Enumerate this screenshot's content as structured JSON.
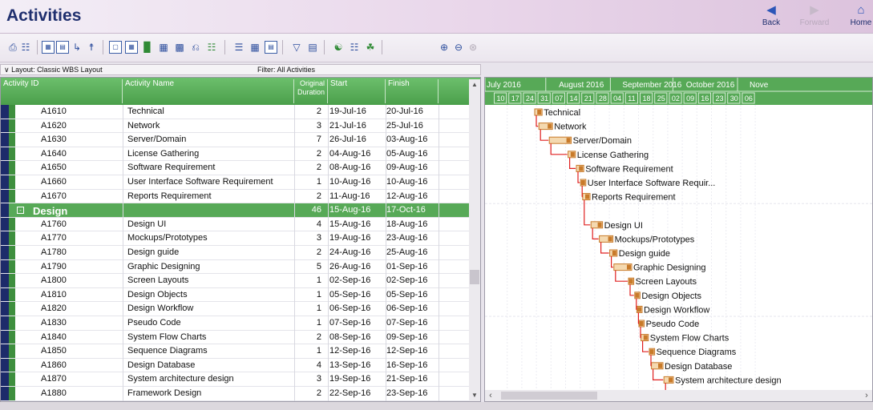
{
  "header": {
    "title": "Activities",
    "back_label": "Back",
    "forward_label": "Forward",
    "home_label": "Home"
  },
  "toolbar": {
    "icons": [
      "print-icon",
      "print-preview-icon",
      "columns-icon",
      "bars-icon",
      "relationship-icon",
      "wbs-icon",
      "layout-icon",
      "table-icon",
      "chart-icon",
      "chart-icon",
      "chart-icon",
      "chart-icon",
      "tree-icon",
      "filter-icon",
      "group-icon",
      "zoom-in-icon",
      "zoom-out-icon"
    ]
  },
  "layoutbar": {
    "layout_label": "∨ Layout: Classic WBS Layout",
    "filter_label": "Filter: All Activities"
  },
  "table": {
    "headers": {
      "activity_id": "Activity ID",
      "activity_name": "Activity Name",
      "duration": "Original Duration",
      "start": "Start",
      "finish": "Finish"
    },
    "rows": [
      {
        "id": "A1610",
        "name": "Technical",
        "dur": "2",
        "start": "19-Jul-16",
        "finish": "20-Jul-16"
      },
      {
        "id": "A1620",
        "name": "Network",
        "dur": "3",
        "start": "21-Jul-16",
        "finish": "25-Jul-16"
      },
      {
        "id": "A1630",
        "name": "Server/Domain",
        "dur": "7",
        "start": "26-Jul-16",
        "finish": "03-Aug-16"
      },
      {
        "id": "A1640",
        "name": "License Gathering",
        "dur": "2",
        "start": "04-Aug-16",
        "finish": "05-Aug-16"
      },
      {
        "id": "A1650",
        "name": "Software Requirement",
        "dur": "2",
        "start": "08-Aug-16",
        "finish": "09-Aug-16"
      },
      {
        "id": "A1660",
        "name": "User Interface Software Requirement",
        "dur": "1",
        "start": "10-Aug-16",
        "finish": "10-Aug-16"
      },
      {
        "id": "A1670",
        "name": "Reports Requirement",
        "dur": "2",
        "start": "11-Aug-16",
        "finish": "12-Aug-16"
      },
      {
        "id": "",
        "name": "Design",
        "dur": "46",
        "start": "15-Aug-16",
        "finish": "17-Oct-16",
        "wbs": true
      },
      {
        "id": "A1760",
        "name": "Design UI",
        "dur": "4",
        "start": "15-Aug-16",
        "finish": "18-Aug-16"
      },
      {
        "id": "A1770",
        "name": "Mockups/Prototypes",
        "dur": "3",
        "start": "19-Aug-16",
        "finish": "23-Aug-16"
      },
      {
        "id": "A1780",
        "name": "Design guide",
        "dur": "2",
        "start": "24-Aug-16",
        "finish": "25-Aug-16"
      },
      {
        "id": "A1790",
        "name": "Graphic Designing",
        "dur": "5",
        "start": "26-Aug-16",
        "finish": "01-Sep-16"
      },
      {
        "id": "A1800",
        "name": "Screen Layouts",
        "dur": "1",
        "start": "02-Sep-16",
        "finish": "02-Sep-16"
      },
      {
        "id": "A1810",
        "name": "Design Objects",
        "dur": "1",
        "start": "05-Sep-16",
        "finish": "05-Sep-16"
      },
      {
        "id": "A1820",
        "name": "Design Workflow",
        "dur": "1",
        "start": "06-Sep-16",
        "finish": "06-Sep-16"
      },
      {
        "id": "A1830",
        "name": "Pseudo Code",
        "dur": "1",
        "start": "07-Sep-16",
        "finish": "07-Sep-16"
      },
      {
        "id": "A1840",
        "name": "System Flow Charts",
        "dur": "2",
        "start": "08-Sep-16",
        "finish": "09-Sep-16"
      },
      {
        "id": "A1850",
        "name": "Sequence Diagrams",
        "dur": "1",
        "start": "12-Sep-16",
        "finish": "12-Sep-16"
      },
      {
        "id": "A1860",
        "name": "Design Database",
        "dur": "4",
        "start": "13-Sep-16",
        "finish": "16-Sep-16"
      },
      {
        "id": "A1870",
        "name": "System architecture design",
        "dur": "3",
        "start": "19-Sep-16",
        "finish": "21-Sep-16"
      },
      {
        "id": "A1880",
        "name": "Framework Design",
        "dur": "2",
        "start": "22-Sep-16",
        "finish": "23-Sep-16"
      }
    ]
  },
  "gantt": {
    "months": [
      "July 2016",
      "August 2016",
      "September 2016",
      "October 2016",
      "Nove"
    ],
    "weeks": [
      "10",
      "17",
      "24",
      "31",
      "07",
      "14",
      "21",
      "28",
      "04",
      "11",
      "18",
      "25",
      "02",
      "09",
      "16",
      "23",
      "30",
      "06"
    ],
    "bar_labels": [
      "Technical",
      "Network",
      "Server/Domain",
      "License Gathering",
      "Software Requirement",
      "User Interface Software Requir...",
      "Reports Requirement",
      "",
      "Design UI",
      "Mockups/Prototypes",
      "Design guide",
      "Graphic Designing",
      "Screen Layouts",
      "Design Objects",
      "Design Workflow",
      "Pseudo Code",
      "System Flow Charts",
      "Sequence Diagrams",
      "Design Database",
      "System architecture design",
      ""
    ],
    "timeline_start": "2016-07-04",
    "colors": {
      "bar": "#c87a2a",
      "bar_fill": "#f4d9b0",
      "link": "#e02020",
      "header": "#57a957"
    }
  }
}
